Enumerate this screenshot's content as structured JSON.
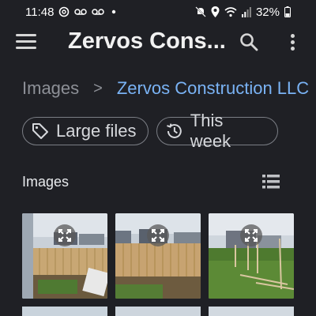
{
  "status_bar": {
    "time": "11:48",
    "battery": "32%",
    "icons": [
      "threads-icon",
      "voicemail-icon",
      "voicemail-icon",
      "dot-icon",
      "mute-icon",
      "location-icon",
      "wifi-icon",
      "signal-icon",
      "battery-icon"
    ]
  },
  "app_bar": {
    "title": "Zervos Cons...",
    "menu_icon": "hamburger-menu-icon",
    "search_icon": "search-icon",
    "more_icon": "more-vert-icon"
  },
  "breadcrumb": {
    "parent": "Images",
    "separator": ">",
    "current": "Zervos Construction LLC"
  },
  "chips": [
    {
      "label": "Large files",
      "icon": "tag-icon"
    },
    {
      "label": "This week",
      "icon": "history-icon"
    }
  ],
  "section": {
    "title": "Images",
    "view_icon": "list-view-icon"
  },
  "images": [
    {
      "name": "fence-photo-1",
      "icon": "expand-icon"
    },
    {
      "name": "fence-photo-2",
      "icon": "expand-icon"
    },
    {
      "name": "fence-photo-3",
      "icon": "expand-icon"
    }
  ],
  "colors": {
    "background": "#1f2025",
    "accent": "#7ab3f5",
    "muted_text": "#8d9097"
  }
}
